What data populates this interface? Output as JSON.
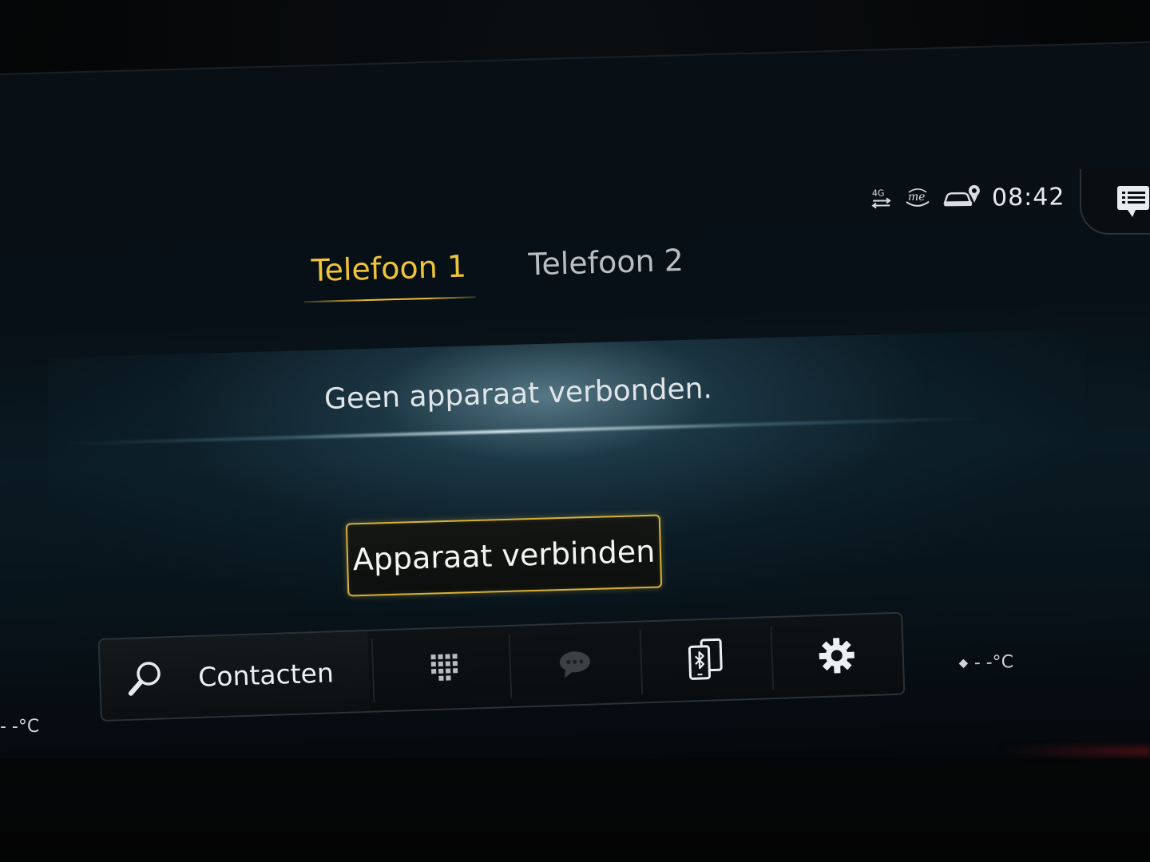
{
  "status_bar": {
    "network_label": "4G",
    "clock": "08:42",
    "icons": [
      "network-4g-icon",
      "mercedes-me-icon",
      "car-location-icon"
    ]
  },
  "tabs": [
    {
      "label": "Telefoon 1",
      "active": true
    },
    {
      "label": "Telefoon 2",
      "active": false
    }
  ],
  "main": {
    "message": "Geen apparaat verbonden.",
    "connect_button": "Apparaat verbinden"
  },
  "dock": {
    "search_label": "Contacten",
    "buttons": [
      "keypad-icon",
      "messages-icon",
      "phone-bluetooth-icon",
      "settings-icon"
    ]
  },
  "climate": {
    "right_temp": "- -°C",
    "left_temp": "- -°C"
  },
  "colors": {
    "accent": "#f0c43a",
    "button_border": "#d7b23a",
    "text": "#dfe5e8"
  }
}
